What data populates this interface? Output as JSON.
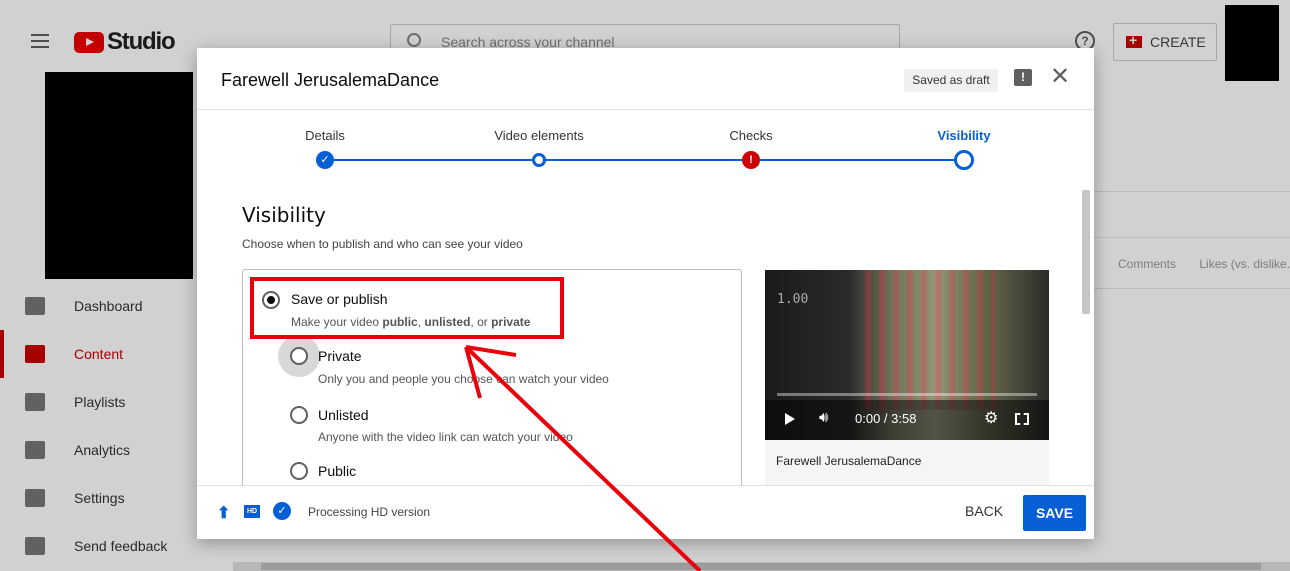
{
  "app": {
    "logo_text": "Studio",
    "search_placeholder": "Search across your channel",
    "help_glyph": "?",
    "create_label": "CREATE"
  },
  "nav": {
    "items": [
      {
        "label": "Dashboard",
        "icon": "dashboard-icon"
      },
      {
        "label": "Content",
        "icon": "content-icon",
        "active": true
      },
      {
        "label": "Playlists",
        "icon": "playlists-icon"
      },
      {
        "label": "Analytics",
        "icon": "analytics-icon"
      },
      {
        "label": "Settings",
        "icon": "settings-icon"
      },
      {
        "label": "Send feedback",
        "icon": "feedback-icon"
      }
    ]
  },
  "background": {
    "columns": [
      "Comments",
      "Likes (vs. dislike..."
    ]
  },
  "dialog": {
    "title": "Farewell JerusalemaDance",
    "saved_badge": "Saved as draft",
    "feedback_glyph": "!",
    "close_glyph": "✕",
    "steps": [
      {
        "label": "Details",
        "state": "complete"
      },
      {
        "label": "Video elements",
        "state": "pending"
      },
      {
        "label": "Checks",
        "state": "error"
      },
      {
        "label": "Visibility",
        "state": "current"
      }
    ],
    "visibility": {
      "heading": "Visibility",
      "subtitle": "Choose when to publish and who can see your video",
      "save_or_publish": {
        "label": "Save or publish",
        "desc_prefix": "Make your video ",
        "desc_public": "public",
        "desc_sep1": ", ",
        "desc_unlisted": "unlisted",
        "desc_sep2": ", or ",
        "desc_private": "private"
      },
      "options": [
        {
          "label": "Private",
          "desc": "Only you and people you choose can watch your video"
        },
        {
          "label": "Unlisted",
          "desc": "Anyone with the video link can watch your video"
        },
        {
          "label": "Public",
          "desc": ""
        }
      ]
    },
    "preview": {
      "speed": "1.00",
      "time": "0:00 / 3:58",
      "video_name": "Farewell JerusalemaDance"
    },
    "footer": {
      "hd_label": "HD",
      "status": "Processing HD version",
      "back_label": "BACK",
      "save_label": "SAVE"
    }
  },
  "colors": {
    "accent": "#065fd4",
    "brand": "#ff0000",
    "annotation": "#e8000b"
  }
}
